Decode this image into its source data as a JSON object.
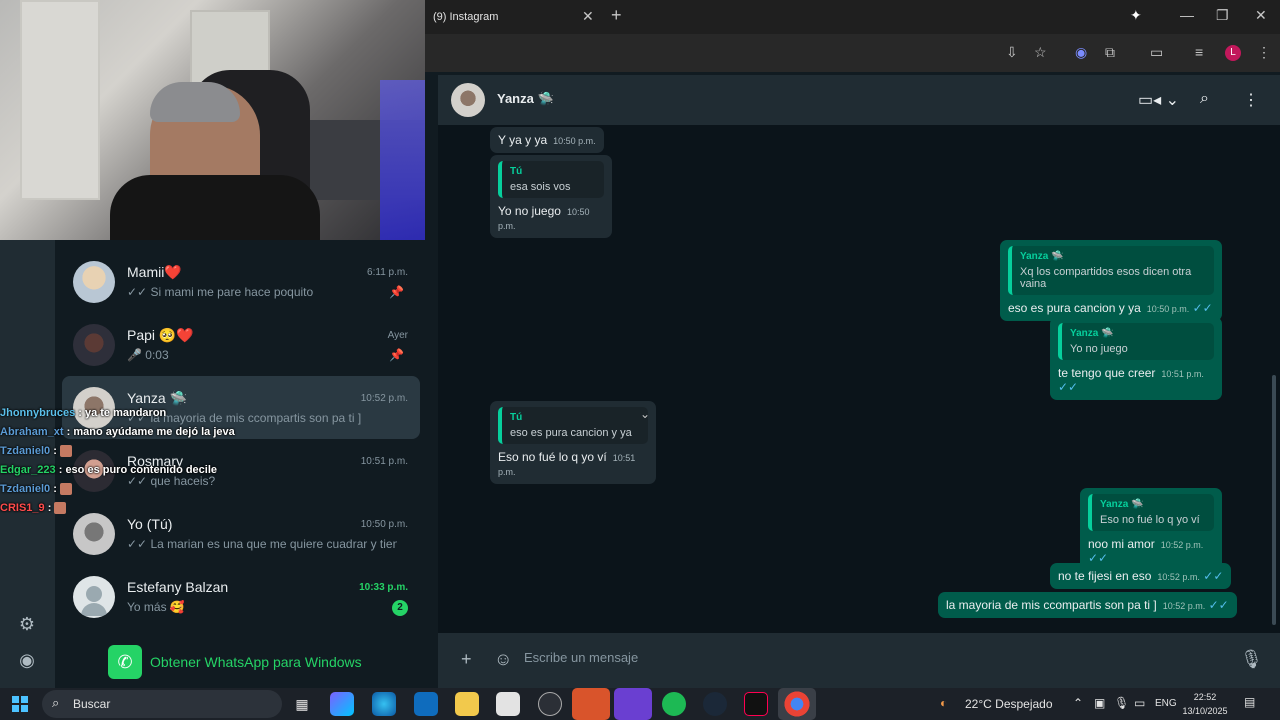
{
  "browser": {
    "tab_title": "(9) Instagram",
    "profile_initial": "L"
  },
  "webcam": {
    "description_icon": "webcam-feed"
  },
  "stream_chat": [
    {
      "user": "Jhonnybruces",
      "msg": ": ya te mandaron",
      "color": "#5bc0eb"
    },
    {
      "user": "Abraham_xt",
      "msg": ": mano ayúdame me dejó la jeva",
      "color": "#5b9bd5"
    },
    {
      "user": "Tzdaniel0",
      "msg": ":",
      "color": "#5b9bd5"
    },
    {
      "user": "Edgar_223",
      "msg": ": eso es puro contenido decile",
      "color": "#25d366"
    },
    {
      "user": "Tzdaniel0",
      "msg": ":",
      "color": "#5b9bd5"
    },
    {
      "user": "CRIS1_9",
      "msg": ":",
      "color": "#ff4b4b"
    }
  ],
  "chat_list": [
    {
      "name": "Mamii❤️",
      "time": "6:11 p.m.",
      "preview": "✓✓ Si mami me pare hace poquito",
      "pinned": true
    },
    {
      "name": "Papi 🥺❤️",
      "time": "Ayer",
      "preview": "🎤 0:03",
      "pinned": true
    },
    {
      "name": "Yanza 🛸",
      "time": "10:52 p.m.",
      "preview": "✓✓ la mayoria de mis ccompartis son pa ti ]"
    },
    {
      "name": "Rosmary",
      "time": "10:51 p.m.",
      "preview": "✓✓ que haceis?"
    },
    {
      "name": "Yo (Tú)",
      "time": "10:50 p.m.",
      "preview": "✓✓ La marian es una que me quiere cuadrar y tiene ..."
    },
    {
      "name": "Estefany Balzan",
      "time": "10:33 p.m.",
      "preview": "Yo más 🥰",
      "unread": "2"
    }
  ],
  "get_whatsapp": "Obtener WhatsApp para Windows",
  "conversation": {
    "contact_name": "Yanza 🛸",
    "composer_placeholder": "Escribe un mensaje",
    "messages": {
      "m1": {
        "text": "Y ya y ya",
        "time": "10:50 p.m."
      },
      "m2": {
        "quote_name": "Tú",
        "quote_text": "esa sois vos",
        "text": "Yo no juego",
        "time": "10:50 p.m."
      },
      "m3": {
        "quote_name": "Yanza 🛸",
        "quote_text": "Xq los compartidos esos dicen otra vaina",
        "text": "eso es pura cancion y ya",
        "time": "10:50 p.m."
      },
      "m4": {
        "quote_name": "Yanza 🛸",
        "quote_text": "Yo no juego",
        "text": "te tengo que creer",
        "time": "10:51 p.m."
      },
      "m5": {
        "quote_name": "Tú",
        "quote_text": "eso es pura cancion y ya",
        "text": "Eso no fué lo q yo ví",
        "time": "10:51 p.m."
      },
      "m6": {
        "quote_name": "Yanza 🛸",
        "quote_text": "Eso no fué lo q yo ví",
        "text": "noo mi amor",
        "time": "10:52 p.m."
      },
      "m7": {
        "text": "no  te fijesi en eso",
        "time": "10:52 p.m."
      },
      "m8": {
        "text": "la mayoria de mis ccompartis son pa ti ]",
        "time": "10:52 p.m."
      }
    }
  },
  "taskbar": {
    "search_label": "Buscar",
    "weather": "22°C Despejado",
    "lang": "ENG",
    "time": "22:52",
    "date": "13/10/2025"
  }
}
